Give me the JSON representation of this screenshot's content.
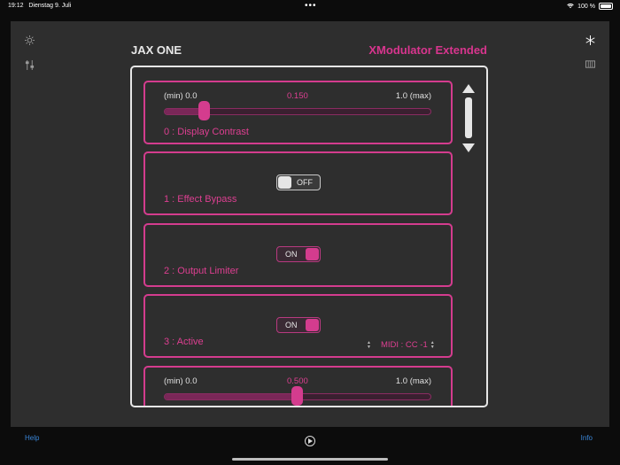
{
  "status_bar": {
    "time": "19:12",
    "date": "Dienstag 9. Juli",
    "dots": "•••",
    "battery": "100 %"
  },
  "header": {
    "device_name": "JAX ONE",
    "plugin_name": "XModulator Extended"
  },
  "cards": [
    {
      "type": "slider",
      "min_label": "(min) 0.0",
      "max_label": "1.0  (max)",
      "value_label": "0.150",
      "value": 0.15,
      "label": "0 : Display Contrast"
    },
    {
      "type": "toggle",
      "state": "OFF",
      "label": "1 : Effect Bypass"
    },
    {
      "type": "toggle",
      "state": "ON",
      "label": "2 : Output Limiter"
    },
    {
      "type": "toggle",
      "state": "ON",
      "label": "3 : Active",
      "midi": "MIDI : CC -1"
    },
    {
      "type": "slider",
      "min_label": "(min) 0.0",
      "max_label": "1.0  (max)",
      "value_label": "0.500",
      "value": 0.5
    }
  ],
  "footer": {
    "help_label": "Help",
    "info_label": "Info"
  },
  "icons": {
    "top_left": "sun-icon",
    "below_left": "sliders-icon",
    "top_right": "snowflake-icon",
    "below_right": "keyboard-icon",
    "bottom_center": "play-icon"
  },
  "colors": {
    "accent": "#d43c8e",
    "link": "#3a86d8"
  }
}
